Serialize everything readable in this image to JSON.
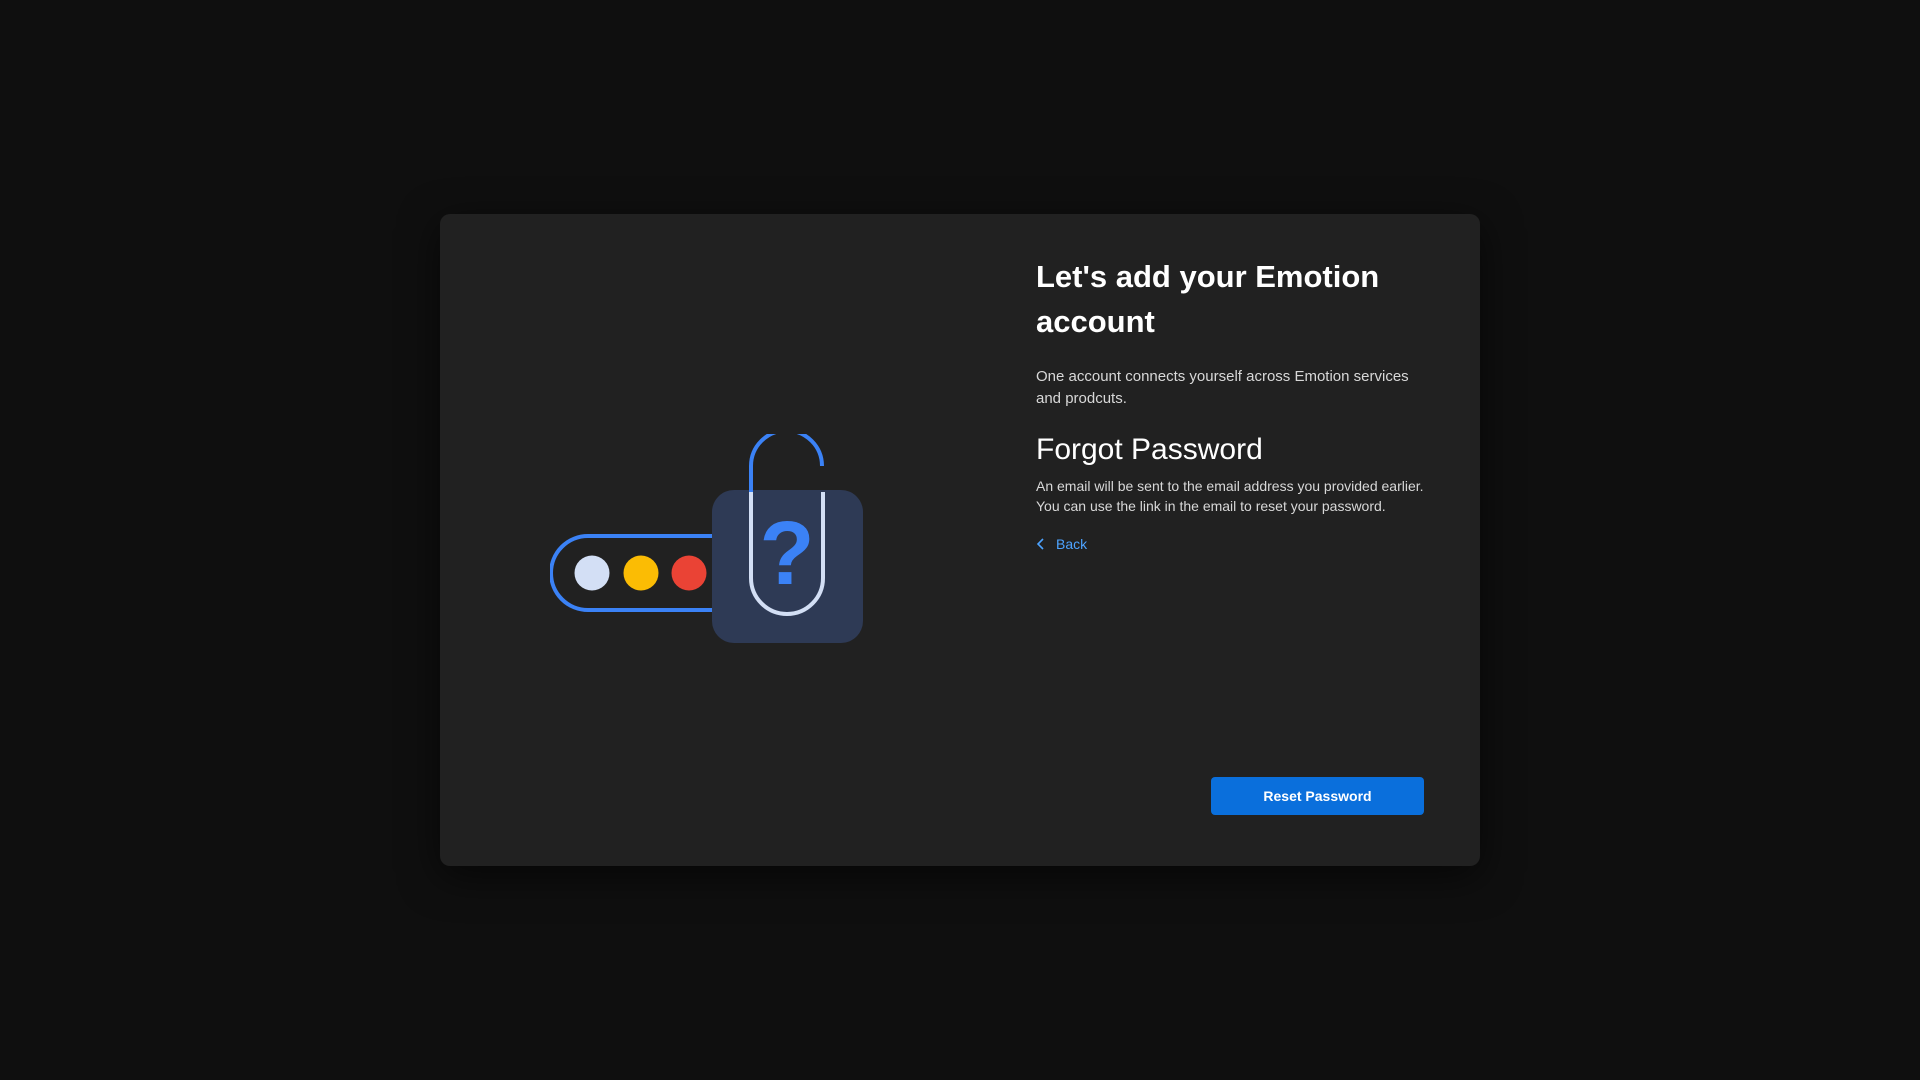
{
  "dialog": {
    "title": "Let's add your Emotion account",
    "subtitle": "One account connects yourself across Emotion services and prodcuts.",
    "section_heading": "Forgot Password",
    "description": "An email will be sent to the email address you provided earlier. You can use the link in the email to reset your password.",
    "back_label": "Back",
    "reset_button_label": "Reset Password"
  },
  "illustration": {
    "lock_symbol": "?",
    "icons": [
      "password-field-icon",
      "padlock-icon",
      "question-mark-icon",
      "chevron-left-icon"
    ],
    "dot_colors": [
      "#d3dff5",
      "#fbbc04",
      "#ea4335",
      "#0da84c"
    ]
  },
  "colors": {
    "background": "#0f0f0f",
    "dialog": "#212121",
    "accent": "#0a6fdc",
    "link": "#4da3ff",
    "illustration_blue": "#3b82f6",
    "lock_body": "#2e3a55"
  }
}
